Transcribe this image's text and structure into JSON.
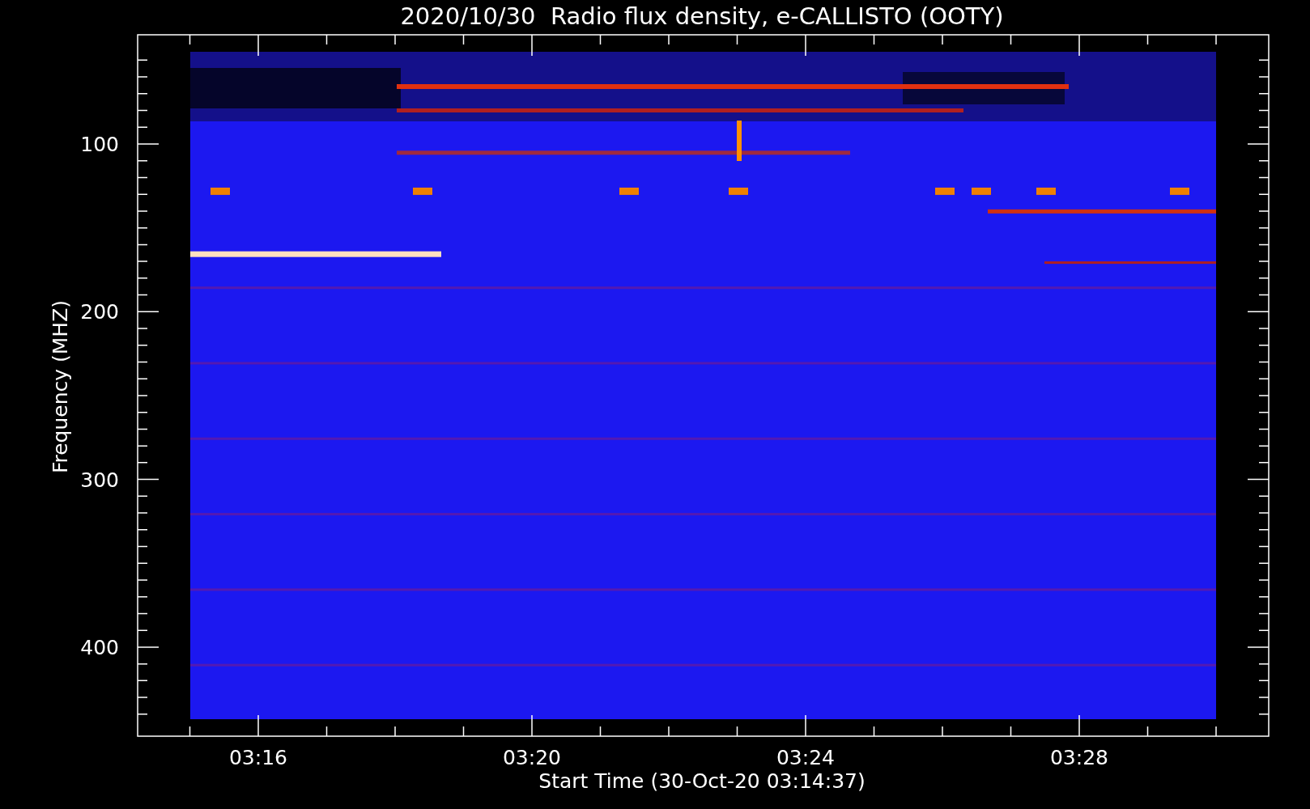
{
  "title": "2020/10/30  Radio flux density, e-CALLISTO (OOTY)",
  "xlabel": "Start Time (30-Oct-20 03:14:37)",
  "ylabel": "Frequency (MHZ)",
  "x_tick_labels": [
    "03:16",
    "03:20",
    "03:24",
    "03:28"
  ],
  "y_tick_labels": [
    "100",
    "200",
    "300",
    "400"
  ]
}
